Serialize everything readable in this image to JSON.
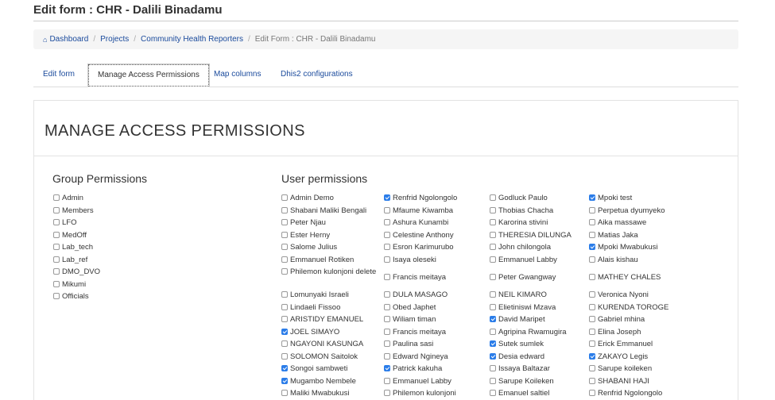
{
  "page": {
    "title": "Edit form : CHR - Dalili Binadamu"
  },
  "breadcrumb": {
    "dashboard": "Dashboard",
    "projects": "Projects",
    "project": "Community Health Reporters",
    "current": "Edit Form : CHR - Dalili Binadamu",
    "separator": "/"
  },
  "tabs": [
    {
      "label": "Edit form"
    },
    {
      "label": "Manage Access Permissions"
    },
    {
      "label": "Map columns"
    },
    {
      "label": "Dhis2 configurations"
    }
  ],
  "panel": {
    "title": "MANAGE ACCESS PERMISSIONS"
  },
  "group_permissions": {
    "heading": "Group Permissions",
    "items": [
      {
        "label": "Admin",
        "checked": false
      },
      {
        "label": "Members",
        "checked": false
      },
      {
        "label": "LFO",
        "checked": false
      },
      {
        "label": "MedOff",
        "checked": false
      },
      {
        "label": "Lab_tech",
        "checked": false
      },
      {
        "label": "Lab_ref",
        "checked": false
      },
      {
        "label": "DMO_DVO",
        "checked": false
      },
      {
        "label": "Mikumi",
        "checked": false
      },
      {
        "label": "Officials",
        "checked": false
      }
    ]
  },
  "user_permissions": {
    "heading": "User permissions",
    "columns": [
      [
        {
          "label": "Admin Demo",
          "checked": false
        },
        {
          "label": "Shabani Maliki Bengali",
          "checked": false
        },
        {
          "label": "Peter Njau",
          "checked": false
        },
        {
          "label": "Ester Herny",
          "checked": false
        },
        {
          "label": "Salome Julius",
          "checked": false
        },
        {
          "label": "Emmanuel Rotiken",
          "checked": false
        },
        {
          "label": "Philemon kulonjoni delete",
          "checked": false
        },
        {
          "label": "Lomunyaki Israeli",
          "checked": false
        },
        {
          "label": "Lindaeli Fissoo",
          "checked": false
        },
        {
          "label": "ARISTIDY EMANUEL",
          "checked": false
        },
        {
          "label": "JOEL SIMAYO",
          "checked": true
        },
        {
          "label": "NGAYONI KASUNGA",
          "checked": false
        },
        {
          "label": "SOLOMON Saitolok",
          "checked": false
        },
        {
          "label": "Songoi sambweti",
          "checked": true
        },
        {
          "label": "Mugambo Nembele",
          "checked": true
        },
        {
          "label": "Maliki Mwabukusi",
          "checked": false
        }
      ],
      [
        {
          "label": "Renfrid Ngolongolo",
          "checked": true
        },
        {
          "label": "Mfaume Kiwamba",
          "checked": false
        },
        {
          "label": "Ashura Kunambi",
          "checked": false
        },
        {
          "label": "Celestine Anthony",
          "checked": false
        },
        {
          "label": "Esron Karimurubo",
          "checked": false
        },
        {
          "label": "Isaya oleseki",
          "checked": false
        },
        {
          "label": "Francis meitaya",
          "checked": false
        },
        {
          "label": "DULA MASAGO",
          "checked": false
        },
        {
          "label": "Obed Japhet",
          "checked": false
        },
        {
          "label": "Wiliam timan",
          "checked": false
        },
        {
          "label": "Francis meitaya",
          "checked": false
        },
        {
          "label": "Paulina sasi",
          "checked": false
        },
        {
          "label": "Edward Ngineya",
          "checked": false
        },
        {
          "label": "Patrick kakuha",
          "checked": true
        },
        {
          "label": "Emmanuel Labby",
          "checked": false
        },
        {
          "label": "Philemon kulonjoni",
          "checked": false
        }
      ],
      [
        {
          "label": "Godluck Paulo",
          "checked": false
        },
        {
          "label": "Thobias Chacha",
          "checked": false
        },
        {
          "label": "Karorina stivini",
          "checked": false
        },
        {
          "label": "THERESIA DILUNGA",
          "checked": false
        },
        {
          "label": "John chilongola",
          "checked": false
        },
        {
          "label": "Emmanuel Labby",
          "checked": false
        },
        {
          "label": "Peter Gwangway",
          "checked": false
        },
        {
          "label": "NEIL KIMARO",
          "checked": false
        },
        {
          "label": "Elietiniswi Mzava",
          "checked": false
        },
        {
          "label": "David Maripet",
          "checked": true
        },
        {
          "label": "Agripina Rwamugira",
          "checked": false
        },
        {
          "label": "Sutek sumlek",
          "checked": true
        },
        {
          "label": "Desia edward",
          "checked": true
        },
        {
          "label": "Issaya Baltazar",
          "checked": false
        },
        {
          "label": "Sarupe Koileken",
          "checked": false
        },
        {
          "label": "Emanuel saltiel",
          "checked": false
        }
      ],
      [
        {
          "label": "Mpoki test",
          "checked": true
        },
        {
          "label": "Perpetua dyumyeko",
          "checked": false
        },
        {
          "label": "Aika massawe",
          "checked": false
        },
        {
          "label": "Matias Jaka",
          "checked": false
        },
        {
          "label": "Mpoki Mwabukusi",
          "checked": true
        },
        {
          "label": "Alais kishau",
          "checked": false
        },
        {
          "label": "MATHEY CHALES",
          "checked": false
        },
        {
          "label": "Veronica Nyoni",
          "checked": false
        },
        {
          "label": "KURENDA TOROGE",
          "checked": false
        },
        {
          "label": "Gabriel mhina",
          "checked": false
        },
        {
          "label": "Elina Joseph",
          "checked": false
        },
        {
          "label": "Erick Emmanuel",
          "checked": false
        },
        {
          "label": "ZAKAYO Legis",
          "checked": true
        },
        {
          "label": "Sarupe koileken",
          "checked": false
        },
        {
          "label": "SHABANI HAJI",
          "checked": false
        },
        {
          "label": "Renfrid Ngolongolo",
          "checked": false
        }
      ]
    ]
  }
}
